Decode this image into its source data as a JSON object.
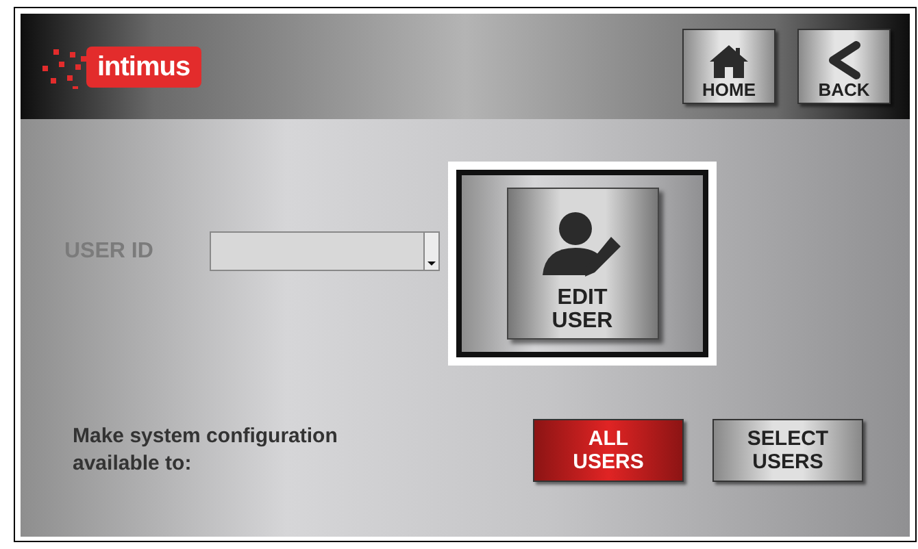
{
  "header": {
    "logo": "intimus",
    "nav_buttons": [
      {
        "kind": "home",
        "label": "HOME"
      },
      {
        "kind": "back",
        "label": "BACK"
      }
    ]
  },
  "user_id": {
    "label": "USER ID",
    "disabled": true
  },
  "edit_user": {
    "label_lines": [
      "EDIT",
      "USER"
    ],
    "highlighted": true
  },
  "availability": {
    "label_lines": [
      "Make system configuration",
      "available to:"
    ],
    "options": [
      {
        "label_lines": [
          "ALL",
          "USERS"
        ],
        "selected": true
      },
      {
        "label_lines": [
          "SELECT",
          "USERS"
        ],
        "selected": false
      }
    ]
  }
}
